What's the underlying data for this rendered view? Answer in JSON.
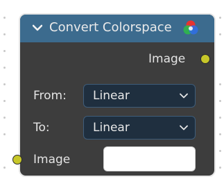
{
  "node": {
    "title": "Convert Colorspace",
    "output": {
      "label": "Image"
    },
    "fields": {
      "from": {
        "label": "From:",
        "value": "Linear"
      },
      "to": {
        "label": "To:",
        "value": "Linear"
      }
    },
    "input": {
      "label": "Image",
      "value": ""
    }
  },
  "icons": {
    "collapse": "chevron-down-icon",
    "colorspace": "rgb-circles-icon",
    "dropdown": "chevron-down-icon"
  },
  "colors": {
    "header": "#3c6b8e",
    "node_body": "#3d3d3d",
    "node_border": "#e6e6e6",
    "socket": "#c7c729",
    "dropdown_bg": "#1f2f3f"
  }
}
